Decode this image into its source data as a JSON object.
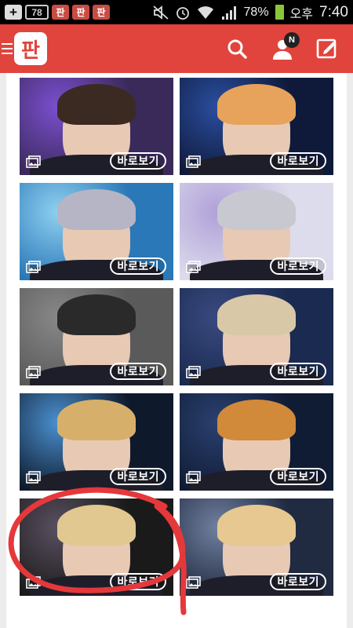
{
  "status_bar": {
    "plus_glyph": "+",
    "badge_count": "78",
    "app_icons": [
      "판",
      "판",
      "판"
    ],
    "battery": "78%",
    "ampm": "오후",
    "time": "7:40",
    "icons": [
      "mute-icon",
      "alarm-icon",
      "wifi-icon",
      "signal-icon",
      "battery-icon"
    ]
  },
  "app_bar": {
    "logo_text": "판",
    "notification_badge": "N",
    "color": "#e0443c",
    "icons": [
      "menu-icon",
      "search-icon",
      "profile-icon",
      "write-icon"
    ]
  },
  "gallery": {
    "view_label": "바로보기",
    "items": [
      {
        "bg": "#3a2a5a",
        "hair": "#3b2a22",
        "accent": "#7b4fd0"
      },
      {
        "bg": "#0f1a3a",
        "hair": "#e7a35b",
        "accent": "#2a4ea0"
      },
      {
        "bg": "#2a78b8",
        "hair": "#b5b5c5",
        "accent": "#8fd0f0"
      },
      {
        "bg": "#dcdcec",
        "hair": "#c8c8d0",
        "accent": "#b0a0d8"
      },
      {
        "bg": "#5a5a5a",
        "hair": "#2a2a2a",
        "accent": "#888888"
      },
      {
        "bg": "#1a2a50",
        "hair": "#d8c8a8",
        "accent": "#3a4a80"
      },
      {
        "bg": "#0e1a2c",
        "hair": "#d6b06a",
        "accent": "#4a90d0"
      },
      {
        "bg": "#101c34",
        "hair": "#d08a3a",
        "accent": "#2a4070"
      },
      {
        "bg": "#1a1a1a",
        "hair": "#e0c890",
        "accent": "#5a5060"
      },
      {
        "bg": "#202a40",
        "hair": "#e6c890",
        "accent": "#7080a0"
      }
    ]
  },
  "annotation": {
    "color": "#e5383b",
    "shape": "hand-drawn circle with tail"
  }
}
